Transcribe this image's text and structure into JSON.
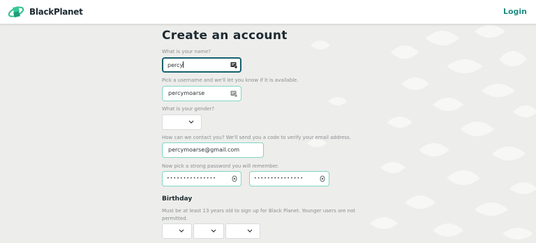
{
  "header": {
    "brand": "BlackPlanet",
    "login_label": "Login",
    "logo_icon": "planet-logo-icon",
    "accent_color": "#1e8e84"
  },
  "form": {
    "title": "Create an account",
    "name": {
      "label": "What is your name?",
      "value": "percy",
      "icon": "contact-card-icon"
    },
    "username": {
      "label": "Pick a username and we'll let you know if it is available.",
      "value": "percymoarse",
      "icon": "contact-card-icon"
    },
    "gender": {
      "label": "What is your gender?",
      "selected": "",
      "icon": "chevron-down-icon"
    },
    "email": {
      "label": "How can we contact you? We'll send you a code to verify your email address.",
      "value": "percymoarse@gmail.com"
    },
    "password": {
      "label": "Now pick a strong password you will remember.",
      "value_masked": "•••••••••••••••",
      "confirm_masked": "•••••••••••••••",
      "icon": "eye-icon"
    },
    "birthday": {
      "title": "Birthday",
      "note": "Must be at least 13 years old to sign up for Black Planet. Younger users are not permitted.",
      "month": "",
      "day": "",
      "year": ""
    }
  }
}
